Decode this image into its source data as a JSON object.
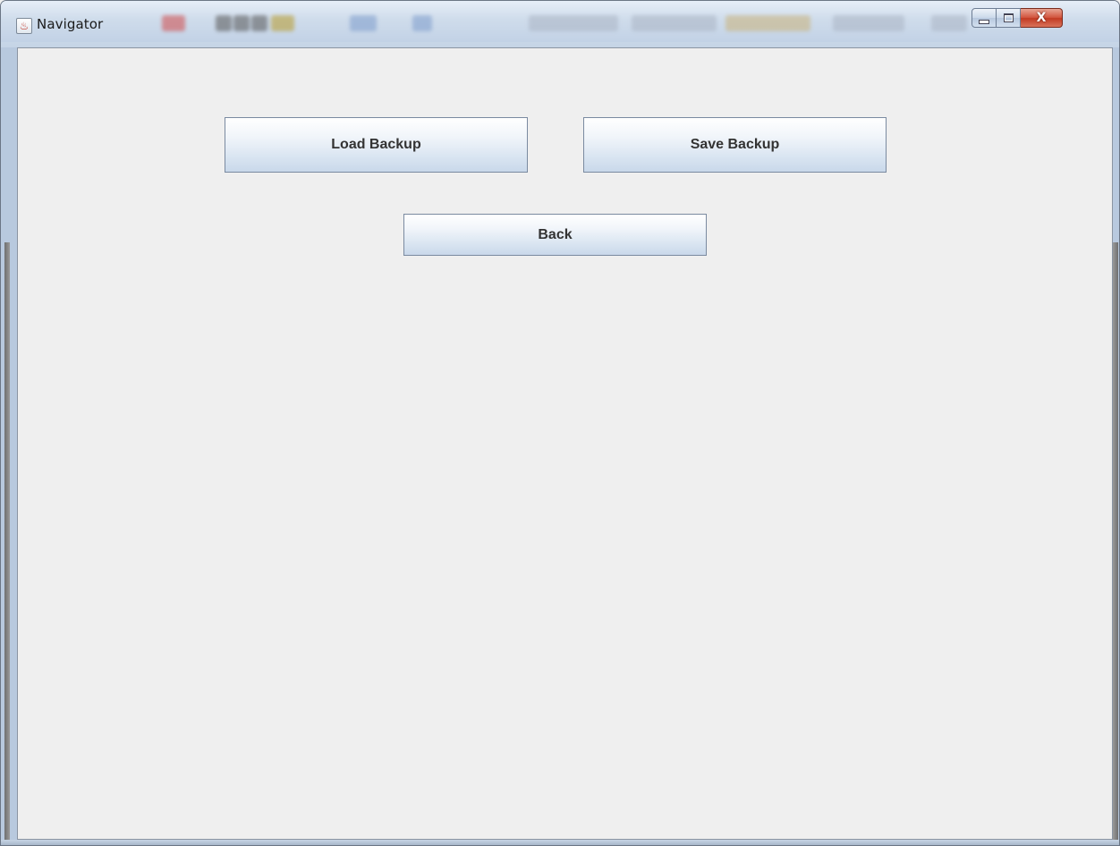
{
  "window": {
    "title": "Navigator",
    "app_icon": "java-icon",
    "caption_buttons": {
      "minimize_icon": "minimize-icon",
      "maximize_icon": "maximize-icon",
      "close_icon": "close-icon",
      "close_glyph": "X"
    }
  },
  "buttons": {
    "load_backup": "Load Backup",
    "save_backup": "Save Backup",
    "back": "Back"
  },
  "colors": {
    "client_background": "#efefef",
    "button_text": "#333333",
    "close_button": "#c23a22"
  }
}
